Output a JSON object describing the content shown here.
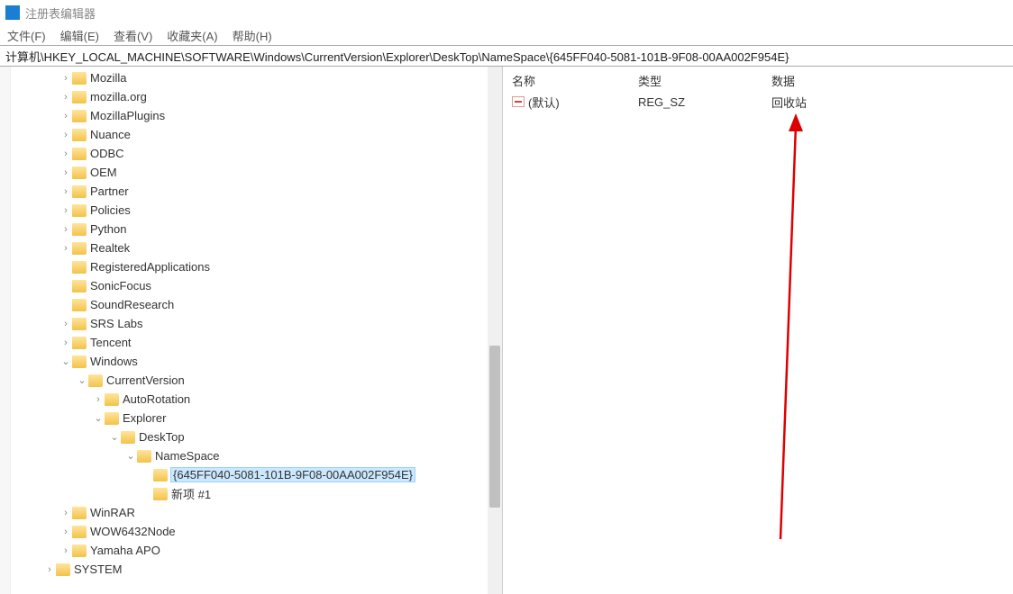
{
  "title": "注册表编辑器",
  "menu": {
    "file": "文件(F)",
    "edit": "编辑(E)",
    "view": "查看(V)",
    "fav": "收藏夹(A)",
    "help": "帮助(H)"
  },
  "address": "计算机\\HKEY_LOCAL_MACHINE\\SOFTWARE\\Windows\\CurrentVersion\\Explorer\\DeskTop\\NameSpace\\{645FF040-5081-101B-9F08-00AA002F954E}",
  "tree": [
    {
      "indent": 3,
      "chev": "closed",
      "label": "Mozilla"
    },
    {
      "indent": 3,
      "chev": "closed",
      "label": "mozilla.org"
    },
    {
      "indent": 3,
      "chev": "closed",
      "label": "MozillaPlugins"
    },
    {
      "indent": 3,
      "chev": "closed",
      "label": "Nuance"
    },
    {
      "indent": 3,
      "chev": "closed",
      "label": "ODBC"
    },
    {
      "indent": 3,
      "chev": "closed",
      "label": "OEM"
    },
    {
      "indent": 3,
      "chev": "closed",
      "label": "Partner"
    },
    {
      "indent": 3,
      "chev": "closed",
      "label": "Policies"
    },
    {
      "indent": 3,
      "chev": "closed",
      "label": "Python"
    },
    {
      "indent": 3,
      "chev": "closed",
      "label": "Realtek"
    },
    {
      "indent": 3,
      "chev": "",
      "label": "RegisteredApplications"
    },
    {
      "indent": 3,
      "chev": "",
      "label": "SonicFocus"
    },
    {
      "indent": 3,
      "chev": "",
      "label": "SoundResearch"
    },
    {
      "indent": 3,
      "chev": "closed",
      "label": "SRS Labs"
    },
    {
      "indent": 3,
      "chev": "closed",
      "label": "Tencent"
    },
    {
      "indent": 3,
      "chev": "open",
      "label": "Windows"
    },
    {
      "indent": 4,
      "chev": "open",
      "label": "CurrentVersion"
    },
    {
      "indent": 5,
      "chev": "closed",
      "label": "AutoRotation"
    },
    {
      "indent": 5,
      "chev": "open",
      "label": "Explorer"
    },
    {
      "indent": 6,
      "chev": "open",
      "label": "DeskTop"
    },
    {
      "indent": 7,
      "chev": "open",
      "label": "NameSpace"
    },
    {
      "indent": 8,
      "chev": "",
      "label": "{645FF040-5081-101B-9F08-00AA002F954E}",
      "sel": true
    },
    {
      "indent": 8,
      "chev": "",
      "label": "新项 #1"
    },
    {
      "indent": 3,
      "chev": "closed",
      "label": "WinRAR"
    },
    {
      "indent": 3,
      "chev": "closed",
      "label": "WOW6432Node"
    },
    {
      "indent": 3,
      "chev": "closed",
      "label": "Yamaha APO"
    },
    {
      "indent": 2,
      "chev": "closed",
      "label": "SYSTEM"
    }
  ],
  "cols": {
    "name": "名称",
    "type": "类型",
    "data": "数据"
  },
  "val": {
    "name": "(默认)",
    "type": "REG_SZ",
    "data": "回收站"
  }
}
